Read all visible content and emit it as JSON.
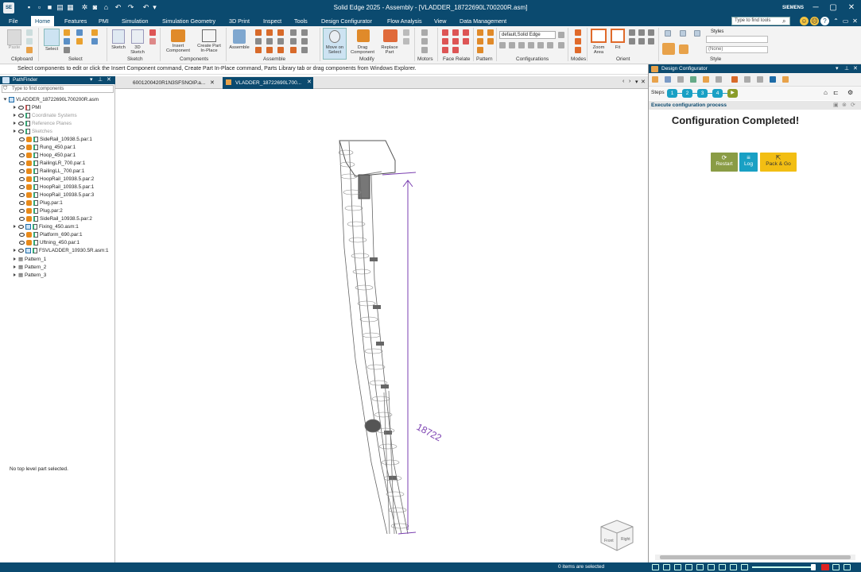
{
  "app": {
    "icon_label": "SE",
    "title": "Solid Edge 2025 - Assembly - [VLADDER_18722690L700200R.asm]",
    "brand": "SIEMENS",
    "quick_access_icons": [
      "new-icon",
      "open-icon",
      "save-icon",
      "print-icon",
      "settings-icon",
      "undo-icon",
      "redo-icon",
      "customize-icon"
    ]
  },
  "menu": {
    "items": [
      "File",
      "Home",
      "Features",
      "PMI",
      "Simulation",
      "Simulation Geometry",
      "3D Print",
      "Inspect",
      "Tools",
      "Design Configurator",
      "Flow Analysis",
      "View",
      "Data Management"
    ],
    "active": "Home",
    "search_placeholder": "Type to find tools"
  },
  "ribbon": {
    "groups": [
      "Clipboard",
      "Select",
      "Sketch",
      "Components",
      "Assemble",
      "Modify",
      "Motors",
      "Face Relate",
      "Pattern",
      "Configurations",
      "Modes",
      "Orient",
      "Style"
    ],
    "buttons": {
      "paste": "Paste",
      "select": "Select",
      "sketch": "Sketch",
      "sketch3d": "3D Sketch",
      "insert_component": "Insert Component",
      "create_part": "Create Part In-Place",
      "assemble": "Assemble",
      "move_on_select": "Move on Select",
      "drag_component": "Drag Component",
      "replace_part": "Replace Part",
      "zoom_area": "Zoom Area",
      "fit": "Fit"
    },
    "configuration_select": "default,Solid Edge",
    "styles_label": "Styles",
    "style_value": "(None)"
  },
  "hint": "Select components to edit or click the Insert Component command, Create Part In-Place command, Parts Library tab or drag components from Windows Explorer.",
  "pathfinder": {
    "title": "PathFinder",
    "search_placeholder": "Type to find components",
    "root": "VLADDER_18722690L700200R.asm",
    "items": [
      {
        "label": "PMI",
        "kind": "pmi",
        "grey": false
      },
      {
        "label": "Coordinate Systems",
        "kind": "sys",
        "grey": true
      },
      {
        "label": "Reference Planes",
        "kind": "sys",
        "grey": true
      },
      {
        "label": "Sketches",
        "kind": "sys",
        "grey": true
      },
      {
        "label": "SideRail_10938.5.par:1",
        "kind": "part",
        "grey": false
      },
      {
        "label": "Rung_450.par:1",
        "kind": "part",
        "grey": false
      },
      {
        "label": "Hoop_450.par:1",
        "kind": "part",
        "grey": false
      },
      {
        "label": "RailingLR_700.par:1",
        "kind": "part",
        "grey": false
      },
      {
        "label": "RailingLL_700.par:1",
        "kind": "part",
        "grey": false
      },
      {
        "label": "HoopRail_10938.5.par:2",
        "kind": "part",
        "grey": false
      },
      {
        "label": "HoopRail_10938.5.par:1",
        "kind": "part",
        "grey": false
      },
      {
        "label": "HoopRail_10938.5.par:3",
        "kind": "part",
        "grey": false
      },
      {
        "label": "Plug.par:1",
        "kind": "part",
        "grey": false
      },
      {
        "label": "Plug.par:2",
        "kind": "part",
        "grey": false
      },
      {
        "label": "SideRail_10938.5.par:2",
        "kind": "part",
        "grey": false
      },
      {
        "label": "Fixing_450.asm:1",
        "kind": "asm",
        "grey": false
      },
      {
        "label": "Platform_690.par:1",
        "kind": "part",
        "grey": false
      },
      {
        "label": "Uftning_450.par:1",
        "kind": "part",
        "grey": false
      },
      {
        "label": "FSVLADDER_10930.5R.asm:1",
        "kind": "asm",
        "grey": false
      },
      {
        "label": "Pattern_1",
        "kind": "pattern",
        "grey": false
      },
      {
        "label": "Pattern_2",
        "kind": "pattern",
        "grey": false
      },
      {
        "label": "Pattern_3",
        "kind": "pattern",
        "grey": false
      }
    ],
    "no_selection": "No top level part selected."
  },
  "tabs": [
    {
      "label": "6001200420R1N3SFSNOIP.a..."
    },
    {
      "label": "VLADDER_18722690L700..."
    }
  ],
  "viewport": {
    "dimension": "18722",
    "cube_front": "Front",
    "cube_right": "Right"
  },
  "configurator": {
    "title": "Design Configurator",
    "steps_label": "Steps",
    "steps": [
      "1",
      "2",
      "3",
      "4"
    ],
    "section": "Execute configuration process",
    "message": "Configuration Completed!",
    "buttons": {
      "restart": "Restart",
      "log": "Log",
      "pack_go": "Pack & Go"
    },
    "colors": {
      "restart": "#8a9c45",
      "log": "#19a0c4",
      "pack_go": "#f2be13"
    }
  },
  "status": {
    "selected": "0 items are selected"
  }
}
